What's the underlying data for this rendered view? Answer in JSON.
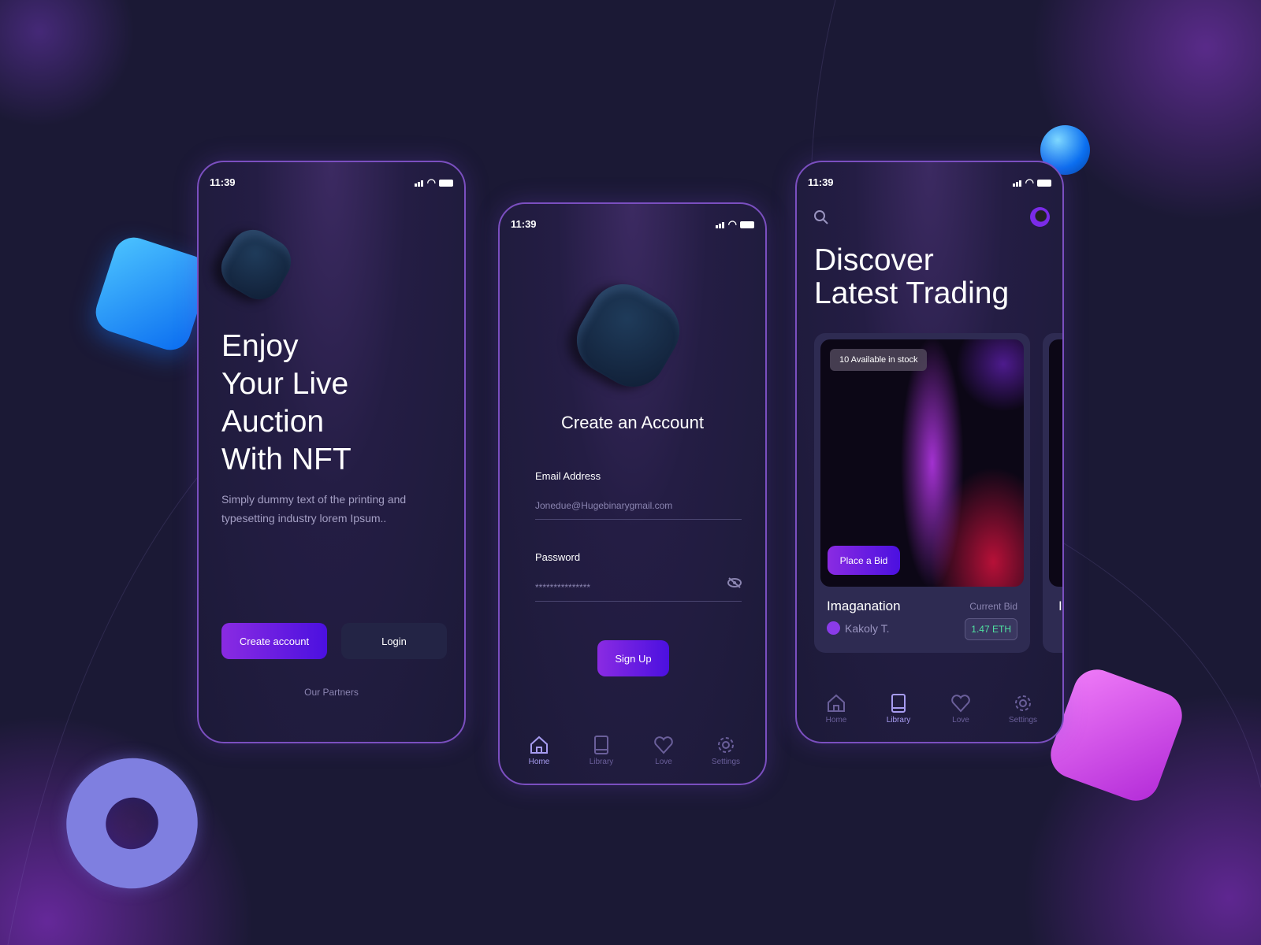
{
  "colors": {
    "accent": "#7a1fe6",
    "border": "#7b4fc0",
    "bid": "#4fe0a0",
    "bg": "#1b1935"
  },
  "status": {
    "time": "11:39"
  },
  "screen1": {
    "headline": [
      "Enjoy",
      "Your Live",
      "Auction",
      "With NFT"
    ],
    "subtitle": "Simply dummy text of the printing and typesetting industry lorem Ipsum..",
    "create_label": "Create account",
    "login_label": "Login",
    "partners": "Our Partners"
  },
  "screen2": {
    "title": "Create an Account",
    "email_label": "Email Address",
    "email_value": "Jonedue@Hugebinarygmail.com",
    "password_label": "Password",
    "password_value": "***************",
    "signup_label": "Sign Up",
    "nav": [
      {
        "label": "Home",
        "icon": "home-icon",
        "active": true
      },
      {
        "label": "Library",
        "icon": "book-icon"
      },
      {
        "label": "Love",
        "icon": "heart-icon"
      },
      {
        "label": "Settings",
        "icon": "gear-icon"
      }
    ]
  },
  "screen3": {
    "title_line1": "Discover",
    "title_line2": "Latest Trading",
    "stock": "10 Available in stock",
    "bid_button": "Place a Bid",
    "name": "Imaganation",
    "creator": "Kakoly T.",
    "bid_label": "Current Bid",
    "bid_value": "1.47 ETH",
    "next_card_initial": "I",
    "nav": [
      {
        "label": "Home",
        "icon": "home-icon"
      },
      {
        "label": "Library",
        "icon": "book-icon",
        "active": true
      },
      {
        "label": "Love",
        "icon": "heart-icon"
      },
      {
        "label": "Settings",
        "icon": "gear-icon"
      }
    ]
  }
}
